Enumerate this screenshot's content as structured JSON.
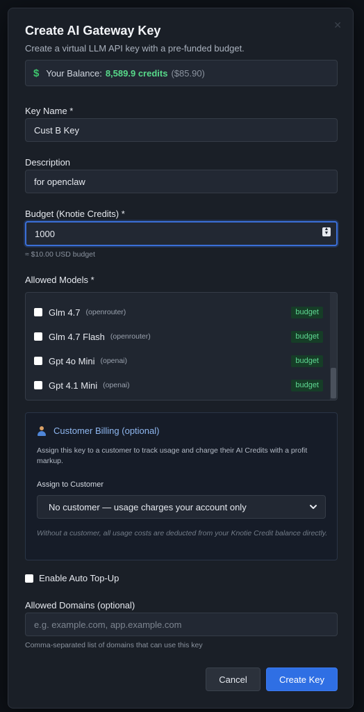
{
  "modal": {
    "title": "Create AI Gateway Key",
    "subtitle": "Create a virtual LLM API key with a pre-funded budget."
  },
  "balance": {
    "icon": "dollar-sign-icon",
    "label": "Your Balance:",
    "credits": "8,589.9 credits",
    "usd": "($85.90)"
  },
  "key_name": {
    "label": "Key Name *",
    "value": "Cust B Key"
  },
  "description": {
    "label": "Description",
    "value": "for openclaw"
  },
  "budget": {
    "label": "Budget (Knotie Credits) *",
    "value": "1000",
    "hint": "≈ $10.00 USD budget"
  },
  "models": {
    "label": "Allowed Models *",
    "items": [
      {
        "name": "Glm 4.7",
        "provider": "(openrouter)",
        "badge": "budget",
        "checked": false
      },
      {
        "name": "Glm 4.7 Flash",
        "provider": "(openrouter)",
        "badge": "budget",
        "checked": false
      },
      {
        "name": "Gpt 4o Mini",
        "provider": "(openai)",
        "badge": "budget",
        "checked": false
      },
      {
        "name": "Gpt 4.1 Mini",
        "provider": "(openai)",
        "badge": "budget",
        "checked": false
      }
    ]
  },
  "billing": {
    "icon": "person-icon",
    "title": "Customer Billing (optional)",
    "description": "Assign this key to a customer to track usage and charge their AI Credits with a profit markup.",
    "assign_label": "Assign to Customer",
    "selected": "No customer — usage charges your account only",
    "note": "Without a customer, all usage costs are deducted from your Knotie Credit balance directly."
  },
  "auto_topup": {
    "label": "Enable Auto Top-Up",
    "checked": false
  },
  "domains": {
    "label": "Allowed Domains (optional)",
    "placeholder": "e.g. example.com, app.example.com",
    "value": "",
    "hint": "Comma-separated list of domains that can use this key"
  },
  "actions": {
    "cancel": "Cancel",
    "create": "Create Key"
  },
  "colors": {
    "accent": "#2f6fe4",
    "credits_green": "#57d98a",
    "badge_bg": "#163d27",
    "billing_title": "#8fb7f0"
  }
}
